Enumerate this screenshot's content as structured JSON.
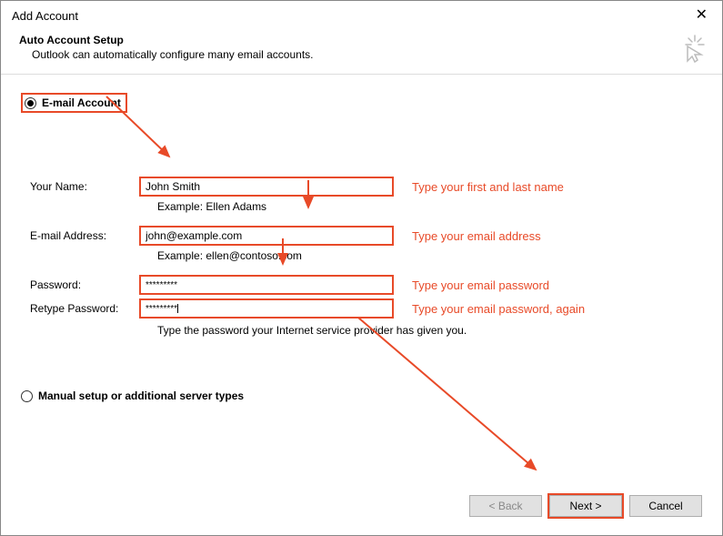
{
  "title": "Add Account",
  "header": {
    "title": "Auto Account Setup",
    "subtitle": "Outlook can automatically configure many email accounts."
  },
  "option_email": "E-mail Account",
  "option_manual": "Manual setup or additional server types",
  "fields": {
    "name_label": "Your Name:",
    "name_value": "John Smith",
    "name_example": "Example: Ellen Adams",
    "email_label": "E-mail Address:",
    "email_value": "john@example.com",
    "email_example": "Example: ellen@contoso.com",
    "password_label": "Password:",
    "password_value": "*********",
    "retype_label": "Retype Password:",
    "retype_value": "*********",
    "password_note": "Type the password your Internet service provider has given you."
  },
  "hints": {
    "name": "Type your first and last name",
    "email": "Type your email address",
    "password": "Type your email password",
    "retype": "Type your email password, again"
  },
  "buttons": {
    "back": "< Back",
    "next": "Next >",
    "cancel": "Cancel"
  },
  "colors": {
    "accent": "#e84a28"
  }
}
